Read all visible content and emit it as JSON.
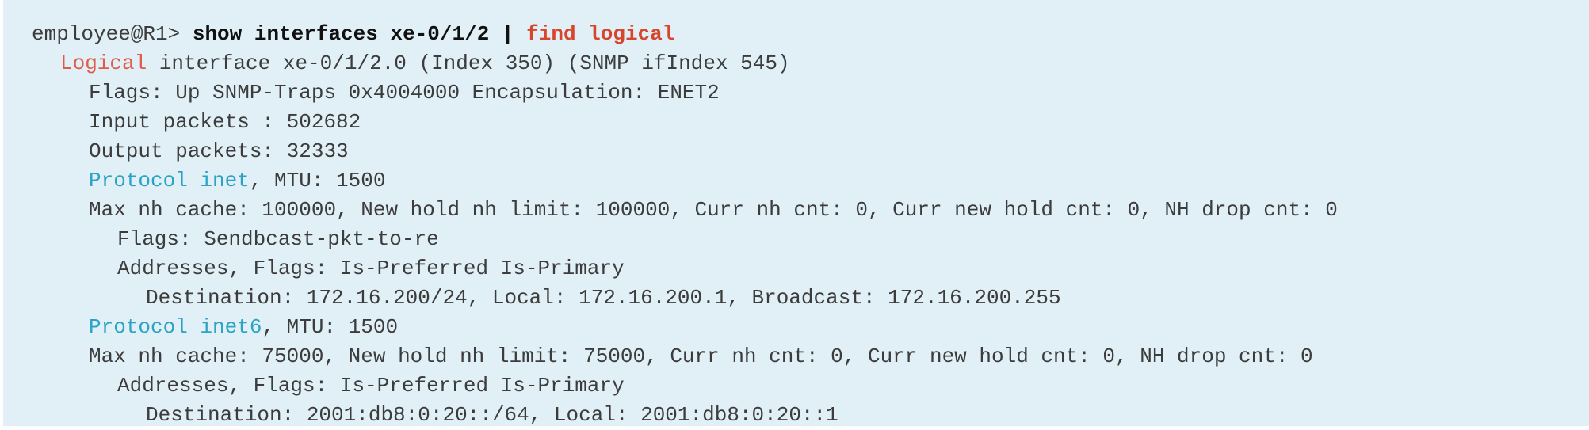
{
  "terminal": {
    "prompt": "employee@R1>",
    "command": "show interfaces xe-0/1/2",
    "pipe": "|",
    "filter": "find logical",
    "logical_keyword": "Logical",
    "logical_rest": "interface xe-0/1/2.0 (Index 350) (SNMP ifIndex 545)",
    "flags_line": "Flags: Up SNMP-Traps 0x4004000 Encapsulation: ENET2",
    "input_packets": "Input packets : 502682",
    "output_packets": "Output packets: 32333",
    "protocol_inet_label": "Protocol inet",
    "protocol_inet_rest": ", MTU: 1500",
    "inet_cache_line": "Max nh cache: 100000, New hold nh limit: 100000, Curr nh cnt: 0, Curr new hold cnt: 0, NH drop cnt: 0",
    "inet_flags_line": "Flags: Sendbcast-pkt-to-re",
    "inet_addr_flags_line": "Addresses, Flags: Is-Preferred Is-Primary",
    "inet_destination_line": "Destination: 172.16.200/24, Local: 172.16.200.1, Broadcast: 172.16.200.255",
    "protocol_inet6_label": "Protocol inet6",
    "protocol_inet6_rest": ", MTU: 1500",
    "inet6_cache_line": "Max nh cache: 75000, New hold nh limit: 75000, Curr nh cnt: 0, Curr new hold cnt: 0, NH drop cnt: 0",
    "inet6_addr_flags_line": "Addresses, Flags: Is-Preferred Is-Primary",
    "inet6_destination_line": "Destination: 2001:db8:0:20::/64, Local: 2001:db8:0:20::1"
  },
  "colors": {
    "background": "#e1f0f7",
    "text": "#3c3c3c",
    "filter_red": "#d9442c",
    "logical_salmon": "#e05c4a",
    "protocol_blue": "#2ca3c4"
  }
}
